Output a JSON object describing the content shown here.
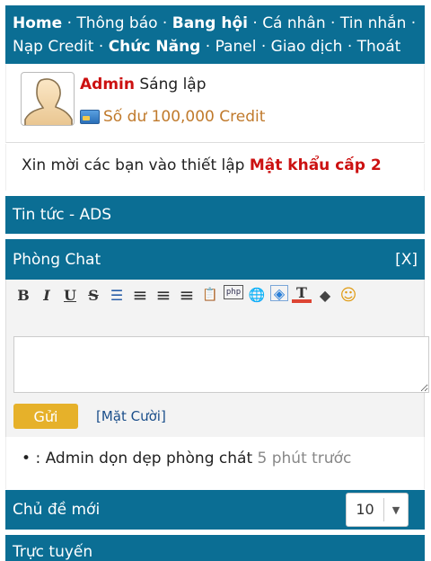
{
  "nav": {
    "items": [
      {
        "label": "Home",
        "bold": true
      },
      {
        "label": "Thông báo",
        "bold": false
      },
      {
        "label": "Bang hội",
        "bold": true
      },
      {
        "label": "Cá nhân",
        "bold": false
      },
      {
        "label": "Tin nhắn",
        "bold": false
      },
      {
        "label": "Nạp Credit",
        "bold": false
      },
      {
        "label": "Chức Năng",
        "bold": true
      },
      {
        "label": "Panel",
        "bold": false
      },
      {
        "label": "Giao dịch",
        "bold": false
      },
      {
        "label": "Thoát",
        "bold": false
      }
    ],
    "separator": "·"
  },
  "user": {
    "name": "Admin",
    "role": "Sáng lập",
    "balance": "Số dư 100,000 Credit"
  },
  "invite": {
    "text": "Xin mời các bạn vào thiết lập",
    "link": "Mật khẩu cấp 2"
  },
  "news": {
    "title": "Tin tức - ADS"
  },
  "chat": {
    "title": "Phòng Chat",
    "close": "[X]",
    "toolbar": [
      {
        "name": "bold-icon",
        "glyph": "B"
      },
      {
        "name": "italic-icon",
        "glyph": "I"
      },
      {
        "name": "underline-icon",
        "glyph": "U"
      },
      {
        "name": "strikethrough-icon",
        "glyph": "S"
      },
      {
        "name": "list-icon",
        "glyph": "☰"
      },
      {
        "name": "align-left-icon",
        "glyph": "≡"
      },
      {
        "name": "align-center-icon",
        "glyph": "≡"
      },
      {
        "name": "align-right-icon",
        "glyph": "≡"
      },
      {
        "name": "code-icon",
        "glyph": "📋"
      },
      {
        "name": "php-icon",
        "glyph": "php"
      },
      {
        "name": "link-icon",
        "glyph": "🌐"
      },
      {
        "name": "html-icon",
        "glyph": "◈"
      },
      {
        "name": "text-color-icon",
        "glyph": "T"
      },
      {
        "name": "background-color-icon",
        "glyph": "◆"
      },
      {
        "name": "smiley-icon",
        "glyph": "☺"
      }
    ],
    "send_label": "Gửi",
    "smiley_label": "[Mặt Cười]",
    "message": {
      "bullet": "•",
      "text": ": Admin dọn dẹp phòng chát",
      "time": "5 phút trước"
    }
  },
  "topics": {
    "title": "Chủ đề mới",
    "selected": "10",
    "arrow": "▼"
  },
  "online": {
    "title": "Trực tuyến"
  }
}
